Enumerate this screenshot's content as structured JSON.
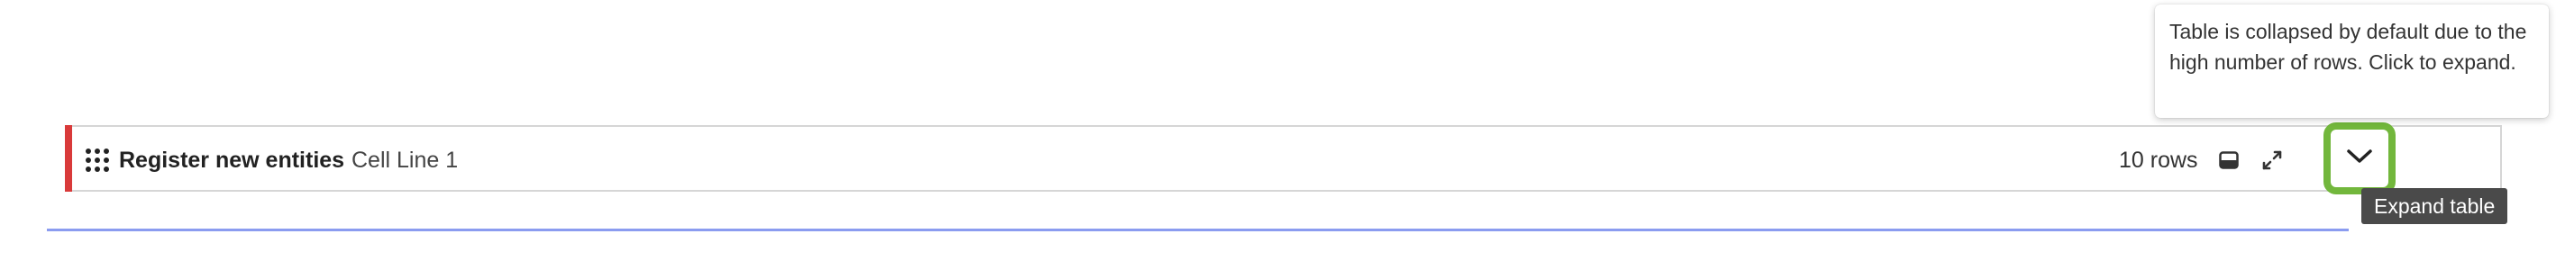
{
  "table": {
    "title": "Register new entities",
    "subtitle": "Cell Line 1",
    "row_count": "10 rows",
    "accent_color": "#d93a3a",
    "icons": {
      "drag": "grid-dots-icon",
      "collapse": "panel-collapse-icon",
      "fullscreen": "expand-arrows-icon",
      "expand": "chevron-down-icon"
    }
  },
  "tooltip": {
    "text": "Table is collapsed by default due to the high number of rows. Click to expand."
  },
  "expand_button": {
    "hover_label": "Expand table",
    "highlight_color": "#72b73c"
  },
  "divider": {
    "color": "#8b9cf0"
  }
}
